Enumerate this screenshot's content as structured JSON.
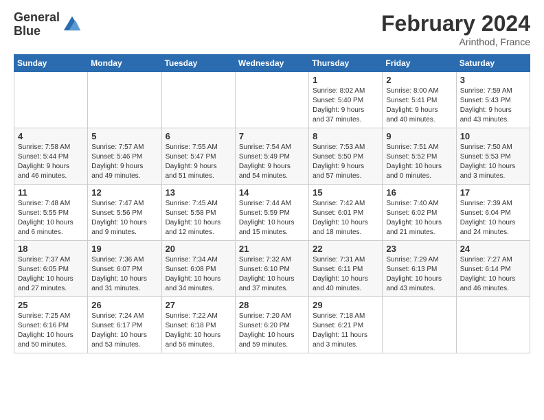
{
  "header": {
    "logo_line1": "General",
    "logo_line2": "Blue",
    "month_year": "February 2024",
    "location": "Arinthod, France"
  },
  "weekdays": [
    "Sunday",
    "Monday",
    "Tuesday",
    "Wednesday",
    "Thursday",
    "Friday",
    "Saturday"
  ],
  "weeks": [
    [
      {
        "day": "",
        "content": ""
      },
      {
        "day": "",
        "content": ""
      },
      {
        "day": "",
        "content": ""
      },
      {
        "day": "",
        "content": ""
      },
      {
        "day": "1",
        "content": "Sunrise: 8:02 AM\nSunset: 5:40 PM\nDaylight: 9 hours\nand 37 minutes."
      },
      {
        "day": "2",
        "content": "Sunrise: 8:00 AM\nSunset: 5:41 PM\nDaylight: 9 hours\nand 40 minutes."
      },
      {
        "day": "3",
        "content": "Sunrise: 7:59 AM\nSunset: 5:43 PM\nDaylight: 9 hours\nand 43 minutes."
      }
    ],
    [
      {
        "day": "4",
        "content": "Sunrise: 7:58 AM\nSunset: 5:44 PM\nDaylight: 9 hours\nand 46 minutes."
      },
      {
        "day": "5",
        "content": "Sunrise: 7:57 AM\nSunset: 5:46 PM\nDaylight: 9 hours\nand 49 minutes."
      },
      {
        "day": "6",
        "content": "Sunrise: 7:55 AM\nSunset: 5:47 PM\nDaylight: 9 hours\nand 51 minutes."
      },
      {
        "day": "7",
        "content": "Sunrise: 7:54 AM\nSunset: 5:49 PM\nDaylight: 9 hours\nand 54 minutes."
      },
      {
        "day": "8",
        "content": "Sunrise: 7:53 AM\nSunset: 5:50 PM\nDaylight: 9 hours\nand 57 minutes."
      },
      {
        "day": "9",
        "content": "Sunrise: 7:51 AM\nSunset: 5:52 PM\nDaylight: 10 hours\nand 0 minutes."
      },
      {
        "day": "10",
        "content": "Sunrise: 7:50 AM\nSunset: 5:53 PM\nDaylight: 10 hours\nand 3 minutes."
      }
    ],
    [
      {
        "day": "11",
        "content": "Sunrise: 7:48 AM\nSunset: 5:55 PM\nDaylight: 10 hours\nand 6 minutes."
      },
      {
        "day": "12",
        "content": "Sunrise: 7:47 AM\nSunset: 5:56 PM\nDaylight: 10 hours\nand 9 minutes."
      },
      {
        "day": "13",
        "content": "Sunrise: 7:45 AM\nSunset: 5:58 PM\nDaylight: 10 hours\nand 12 minutes."
      },
      {
        "day": "14",
        "content": "Sunrise: 7:44 AM\nSunset: 5:59 PM\nDaylight: 10 hours\nand 15 minutes."
      },
      {
        "day": "15",
        "content": "Sunrise: 7:42 AM\nSunset: 6:01 PM\nDaylight: 10 hours\nand 18 minutes."
      },
      {
        "day": "16",
        "content": "Sunrise: 7:40 AM\nSunset: 6:02 PM\nDaylight: 10 hours\nand 21 minutes."
      },
      {
        "day": "17",
        "content": "Sunrise: 7:39 AM\nSunset: 6:04 PM\nDaylight: 10 hours\nand 24 minutes."
      }
    ],
    [
      {
        "day": "18",
        "content": "Sunrise: 7:37 AM\nSunset: 6:05 PM\nDaylight: 10 hours\nand 27 minutes."
      },
      {
        "day": "19",
        "content": "Sunrise: 7:36 AM\nSunset: 6:07 PM\nDaylight: 10 hours\nand 31 minutes."
      },
      {
        "day": "20",
        "content": "Sunrise: 7:34 AM\nSunset: 6:08 PM\nDaylight: 10 hours\nand 34 minutes."
      },
      {
        "day": "21",
        "content": "Sunrise: 7:32 AM\nSunset: 6:10 PM\nDaylight: 10 hours\nand 37 minutes."
      },
      {
        "day": "22",
        "content": "Sunrise: 7:31 AM\nSunset: 6:11 PM\nDaylight: 10 hours\nand 40 minutes."
      },
      {
        "day": "23",
        "content": "Sunrise: 7:29 AM\nSunset: 6:13 PM\nDaylight: 10 hours\nand 43 minutes."
      },
      {
        "day": "24",
        "content": "Sunrise: 7:27 AM\nSunset: 6:14 PM\nDaylight: 10 hours\nand 46 minutes."
      }
    ],
    [
      {
        "day": "25",
        "content": "Sunrise: 7:25 AM\nSunset: 6:16 PM\nDaylight: 10 hours\nand 50 minutes."
      },
      {
        "day": "26",
        "content": "Sunrise: 7:24 AM\nSunset: 6:17 PM\nDaylight: 10 hours\nand 53 minutes."
      },
      {
        "day": "27",
        "content": "Sunrise: 7:22 AM\nSunset: 6:18 PM\nDaylight: 10 hours\nand 56 minutes."
      },
      {
        "day": "28",
        "content": "Sunrise: 7:20 AM\nSunset: 6:20 PM\nDaylight: 10 hours\nand 59 minutes."
      },
      {
        "day": "29",
        "content": "Sunrise: 7:18 AM\nSunset: 6:21 PM\nDaylight: 11 hours\nand 3 minutes."
      },
      {
        "day": "",
        "content": ""
      },
      {
        "day": "",
        "content": ""
      }
    ]
  ]
}
